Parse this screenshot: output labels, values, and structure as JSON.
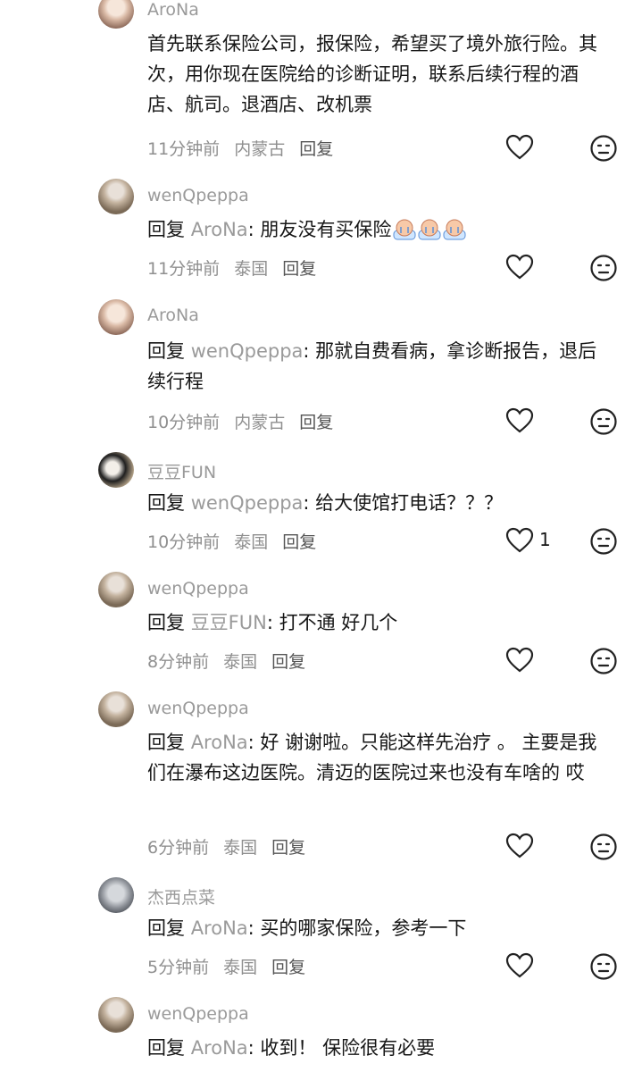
{
  "comments": [
    {
      "user": "AroNa",
      "avatar": "avatar-arona",
      "text": "首先联系保险公司，报保险，希望买了境外旅行险。其次，用你现在医院给的诊断证明，联系后续行程的酒店、航司。退酒店、改机票",
      "time": "11分钟前",
      "location": "内蒙古",
      "reply_label": "回复"
    },
    {
      "user": "wenQpeppa",
      "avatar": "avatar-wenq",
      "reply_prefix": "回复",
      "reply_to": "AroNa",
      "text": ": 朋友没有买保险",
      "emoji_names": [
        "crying-face-icon",
        "crying-face-icon",
        "crying-face-icon"
      ],
      "time": "11分钟前",
      "location": "泰国",
      "reply_label": "回复"
    },
    {
      "user": "AroNa",
      "avatar": "avatar-arona",
      "reply_prefix": "回复",
      "reply_to": "wenQpeppa",
      "text": ": 那就自费看病，拿诊断报告，退后续行程",
      "time": "10分钟前",
      "location": "内蒙古",
      "reply_label": "回复"
    },
    {
      "user": "豆豆FUN",
      "avatar": "avatar-doudou",
      "reply_prefix": "回复",
      "reply_to": "wenQpeppa",
      "text": ": 给大使馆打电话？？？",
      "time": "10分钟前",
      "location": "泰国",
      "reply_label": "回复",
      "likes": "1"
    },
    {
      "user": "wenQpeppa",
      "avatar": "avatar-wenq",
      "reply_prefix": "回复",
      "reply_to": "豆豆FUN",
      "text": ": 打不通 好几个",
      "time": "8分钟前",
      "location": "泰国",
      "reply_label": "回复"
    },
    {
      "user": "wenQpeppa",
      "avatar": "avatar-wenq",
      "reply_prefix": "回复",
      "reply_to": "AroNa",
      "text": ": 好 谢谢啦。只能这样先治疗 。 主要是我们在瀑布这边医院。清迈的医院过来也没有车啥的 哎",
      "time": "6分钟前",
      "location": "泰国",
      "reply_label": "回复"
    },
    {
      "user": "杰西点菜",
      "avatar": "avatar-jiexi",
      "reply_prefix": "回复",
      "reply_to": "AroNa",
      "text": ": 买的哪家保险，参考一下",
      "time": "5分钟前",
      "location": "泰国",
      "reply_label": "回复"
    },
    {
      "user": "wenQpeppa",
      "avatar": "avatar-wenq",
      "reply_prefix": "回复",
      "reply_to": "AroNa",
      "text": ": 收到！ 保险很有必要"
    }
  ]
}
